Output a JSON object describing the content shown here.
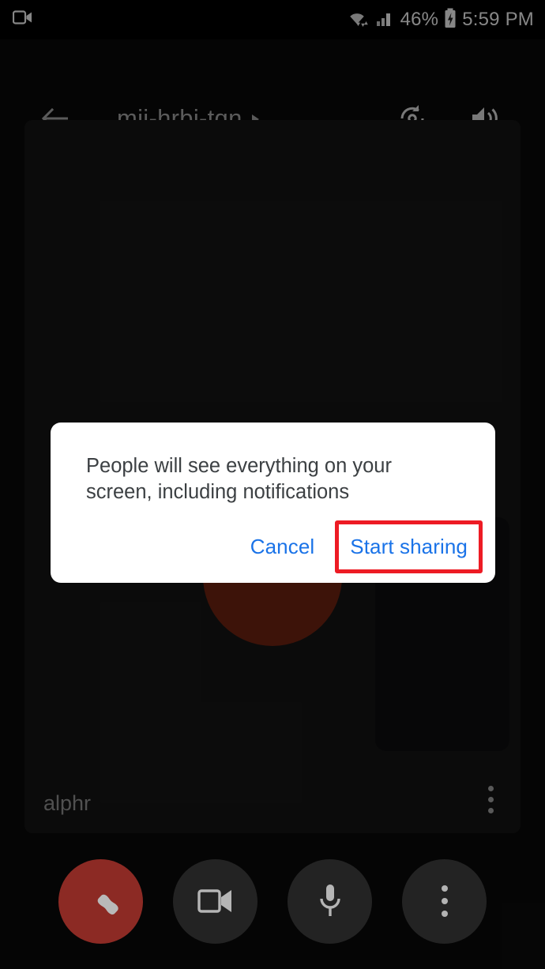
{
  "status_bar": {
    "left_icon": "video-camera-icon",
    "wifi_icon": "wifi-with-data-arrows-icon",
    "signal_icon": "cellular-signal-icon",
    "battery_percent": "46%",
    "battery_icon": "battery-charging-icon",
    "time": "5:59 PM"
  },
  "header": {
    "back_icon": "back-arrow-icon",
    "meeting_code": "mji-hrbj-tqn",
    "expand_icon": "triangle-right-icon",
    "flip_camera_icon": "flip-camera-icon",
    "speaker_icon": "speaker-volume-icon"
  },
  "main_tile": {
    "participant_name": "alphr",
    "menu_icon": "more-options-vertical-icon",
    "avatar_name": "participant-avatar",
    "avatar_color": "#6a2211"
  },
  "self_view": {
    "name": "self-view-tile"
  },
  "dialog": {
    "message": "People will see everything on your screen, including notifications",
    "cancel_label": "Cancel",
    "confirm_label": "Start sharing",
    "accent_color": "#1a73e8",
    "highlight_color": "#ed1b24",
    "background_color": "#ffffff",
    "text_color": "#3c4043"
  },
  "controls": {
    "end_call_label": "end-call",
    "end_call_icon": "phone-hangup-icon",
    "end_call_color": "#8c2a24",
    "camera_icon": "video-camera-icon",
    "microphone_icon": "microphone-icon",
    "more_icon": "more-options-vertical-icon"
  }
}
